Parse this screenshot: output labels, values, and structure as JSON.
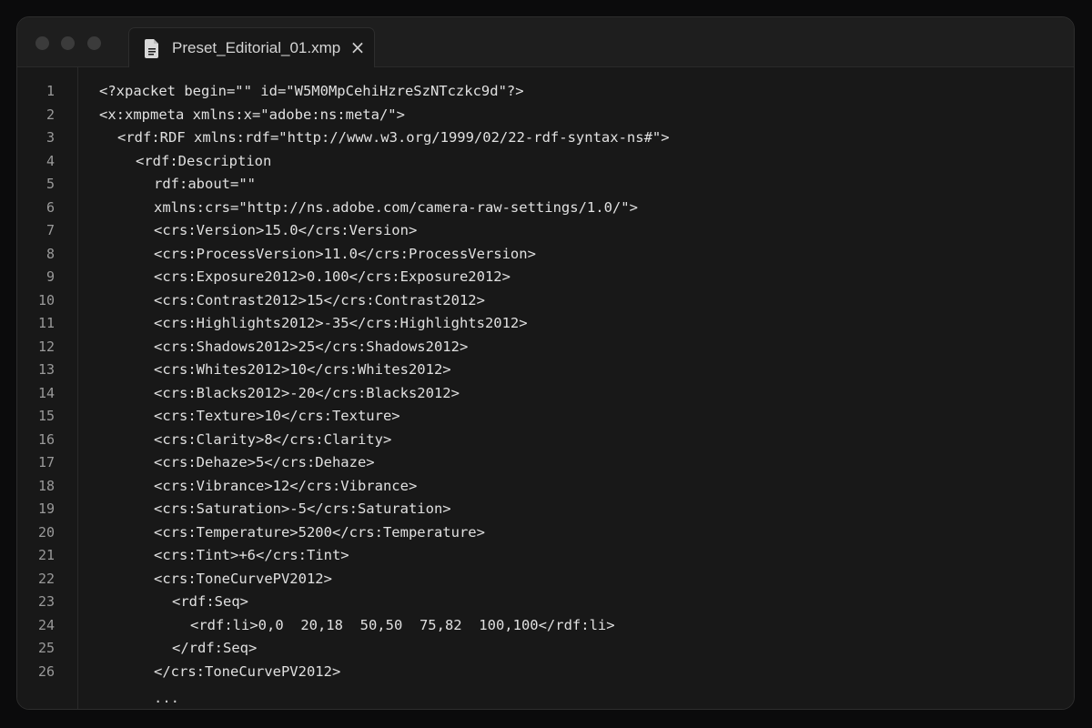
{
  "window": {
    "tab": {
      "label": "Preset_Editorial_01.xmp",
      "icon": "document-icon",
      "close_symbol": "×"
    }
  },
  "editor": {
    "lines": [
      {
        "number": "1",
        "text": "<?xpacket begin=\"\" id=\"W5M0MpCehiHzreSzNTczkc9d\"?>",
        "indent": 0
      },
      {
        "number": "2",
        "text": "<x:xmpmeta xmlns:x=\"adobe:ns:meta/\">",
        "indent": 0
      },
      {
        "number": "3",
        "text": "<rdf:RDF xmlns:rdf=\"http://www.w3.org/1999/02/22-rdf-syntax-ns#\">",
        "indent": 1
      },
      {
        "number": "4",
        "text": "<rdf:Description",
        "indent": 2
      },
      {
        "number": "5",
        "text": "rdf:about=\"\"",
        "indent": 3
      },
      {
        "number": "6",
        "text": "xmlns:crs=\"http://ns.adobe.com/camera-raw-settings/1.0/\">",
        "indent": 3
      },
      {
        "number": "7",
        "text": "<crs:Version>15.0</crs:Version>",
        "indent": 3
      },
      {
        "number": "8",
        "text": "<crs:ProcessVersion>11.0</crs:ProcessVersion>",
        "indent": 3
      },
      {
        "number": "9",
        "text": "<crs:Exposure2012>0.100</crs:Exposure2012>",
        "indent": 3
      },
      {
        "number": "10",
        "text": "<crs:Contrast2012>15</crs:Contrast2012>",
        "indent": 3
      },
      {
        "number": "11",
        "text": "<crs:Highlights2012>-35</crs:Highlights2012>",
        "indent": 3
      },
      {
        "number": "12",
        "text": "<crs:Shadows2012>25</crs:Shadows2012>",
        "indent": 3
      },
      {
        "number": "13",
        "text": "<crs:Whites2012>10</crs:Whites2012>",
        "indent": 3
      },
      {
        "number": "14",
        "text": "<crs:Blacks2012>-20</crs:Blacks2012>",
        "indent": 3
      },
      {
        "number": "15",
        "text": "<crs:Texture>10</crs:Texture>",
        "indent": 3
      },
      {
        "number": "16",
        "text": "<crs:Clarity>8</crs:Clarity>",
        "indent": 3
      },
      {
        "number": "17",
        "text": "<crs:Dehaze>5</crs:Dehaze>",
        "indent": 3
      },
      {
        "number": "18",
        "text": "<crs:Vibrance>12</crs:Vibrance>",
        "indent": 3
      },
      {
        "number": "19",
        "text": "<crs:Saturation>-5</crs:Saturation>",
        "indent": 3
      },
      {
        "number": "20",
        "text": "<crs:Temperature>5200</crs:Temperature>",
        "indent": 3
      },
      {
        "number": "21",
        "text": "<crs:Tint>+6</crs:Tint>",
        "indent": 3
      },
      {
        "number": "22",
        "text": "<crs:ToneCurvePV2012>",
        "indent": 3
      },
      {
        "number": "23",
        "text": "<rdf:Seq>",
        "indent": 4
      },
      {
        "number": "24",
        "text": "<rdf:li>0,0  20,18  50,50  75,82  100,100</rdf:li>",
        "indent": 5
      },
      {
        "number": "25",
        "text": "</rdf:Seq>",
        "indent": 4
      },
      {
        "number": "26",
        "text": "</crs:ToneCurvePV2012>",
        "indent": 3
      }
    ],
    "ellipsis": "..."
  },
  "colors": {
    "background": "#181818",
    "titlebar": "#1e1e1e",
    "border": "#2d2d2d",
    "text": "#e0e0e0",
    "line_numbers": "#9a9a9a"
  }
}
